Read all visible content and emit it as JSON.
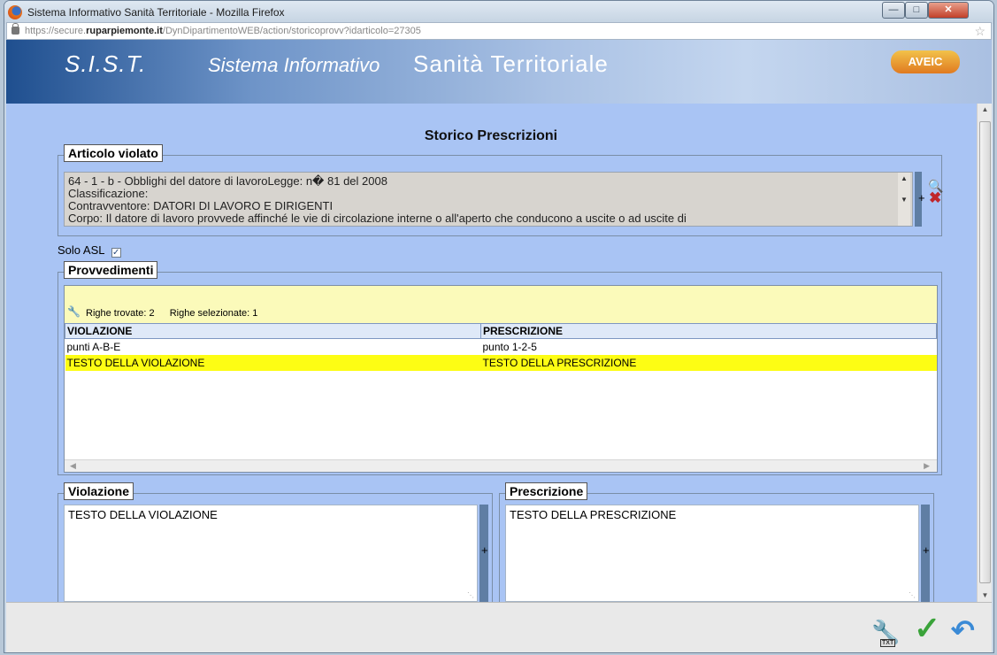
{
  "window": {
    "title": "Sistema Informativo Sanità Territoriale - Mozilla Firefox",
    "url_prefix": "https://secure.",
    "url_domain": "ruparpiemonte.it",
    "url_path": "/DynDipartimentoWEB/action/storicoprovv?idarticolo=27305"
  },
  "banner": {
    "sist": "S.I.S.T.",
    "sistema_informativo": "Sistema Informativo",
    "sanita_territoriale": "Sanità Territoriale",
    "logo": "AVEIC"
  },
  "page_title": "Storico Prescrizioni",
  "articolo": {
    "legend": "Articolo violato",
    "lines": [
      "64 - 1 - b - Obblighi del datore di lavoroLegge: n� 81 del 2008",
      "Classificazione:",
      "Contravventore: DATORI DI LAVORO E DIRIGENTI",
      "Corpo: Il datore di lavoro provvede affinché le vie di circolazione interne o all'aperto che conducono a uscite o ad uscite di"
    ],
    "plus": "+"
  },
  "solo_asl": {
    "label": "Solo ASL",
    "checked": true,
    "mark": "✓"
  },
  "provvedimenti": {
    "legend": "Provvedimenti",
    "righe_trovate": "Righe trovate: 2",
    "righe_selezionate": "Righe selezionate: 1",
    "columns": [
      "VIOLAZIONE",
      "PRESCRIZIONE"
    ],
    "rows": [
      {
        "violazione": "punti A-B-E",
        "prescrizione": "punto 1-2-5",
        "selected": false
      },
      {
        "violazione": "TESTO DELLA VIOLAZIONE",
        "prescrizione": "TESTO DELLA PRESCRIZIONE",
        "selected": true
      }
    ]
  },
  "violazione": {
    "legend": "Violazione",
    "value": "TESTO DELLA VIOLAZIONE",
    "plus": "+"
  },
  "prescrizione": {
    "legend": "Prescrizione",
    "value": "TESTO DELLA PRESCRIZIONE",
    "plus": "+"
  },
  "footer": {
    "txt_label": "TXT"
  },
  "colors": {
    "content_bg": "#a9c4f4",
    "selected_row": "#fdfd14",
    "toolbar_yellow": "#fbfaba",
    "accent_blue": "#5f7ea4"
  }
}
